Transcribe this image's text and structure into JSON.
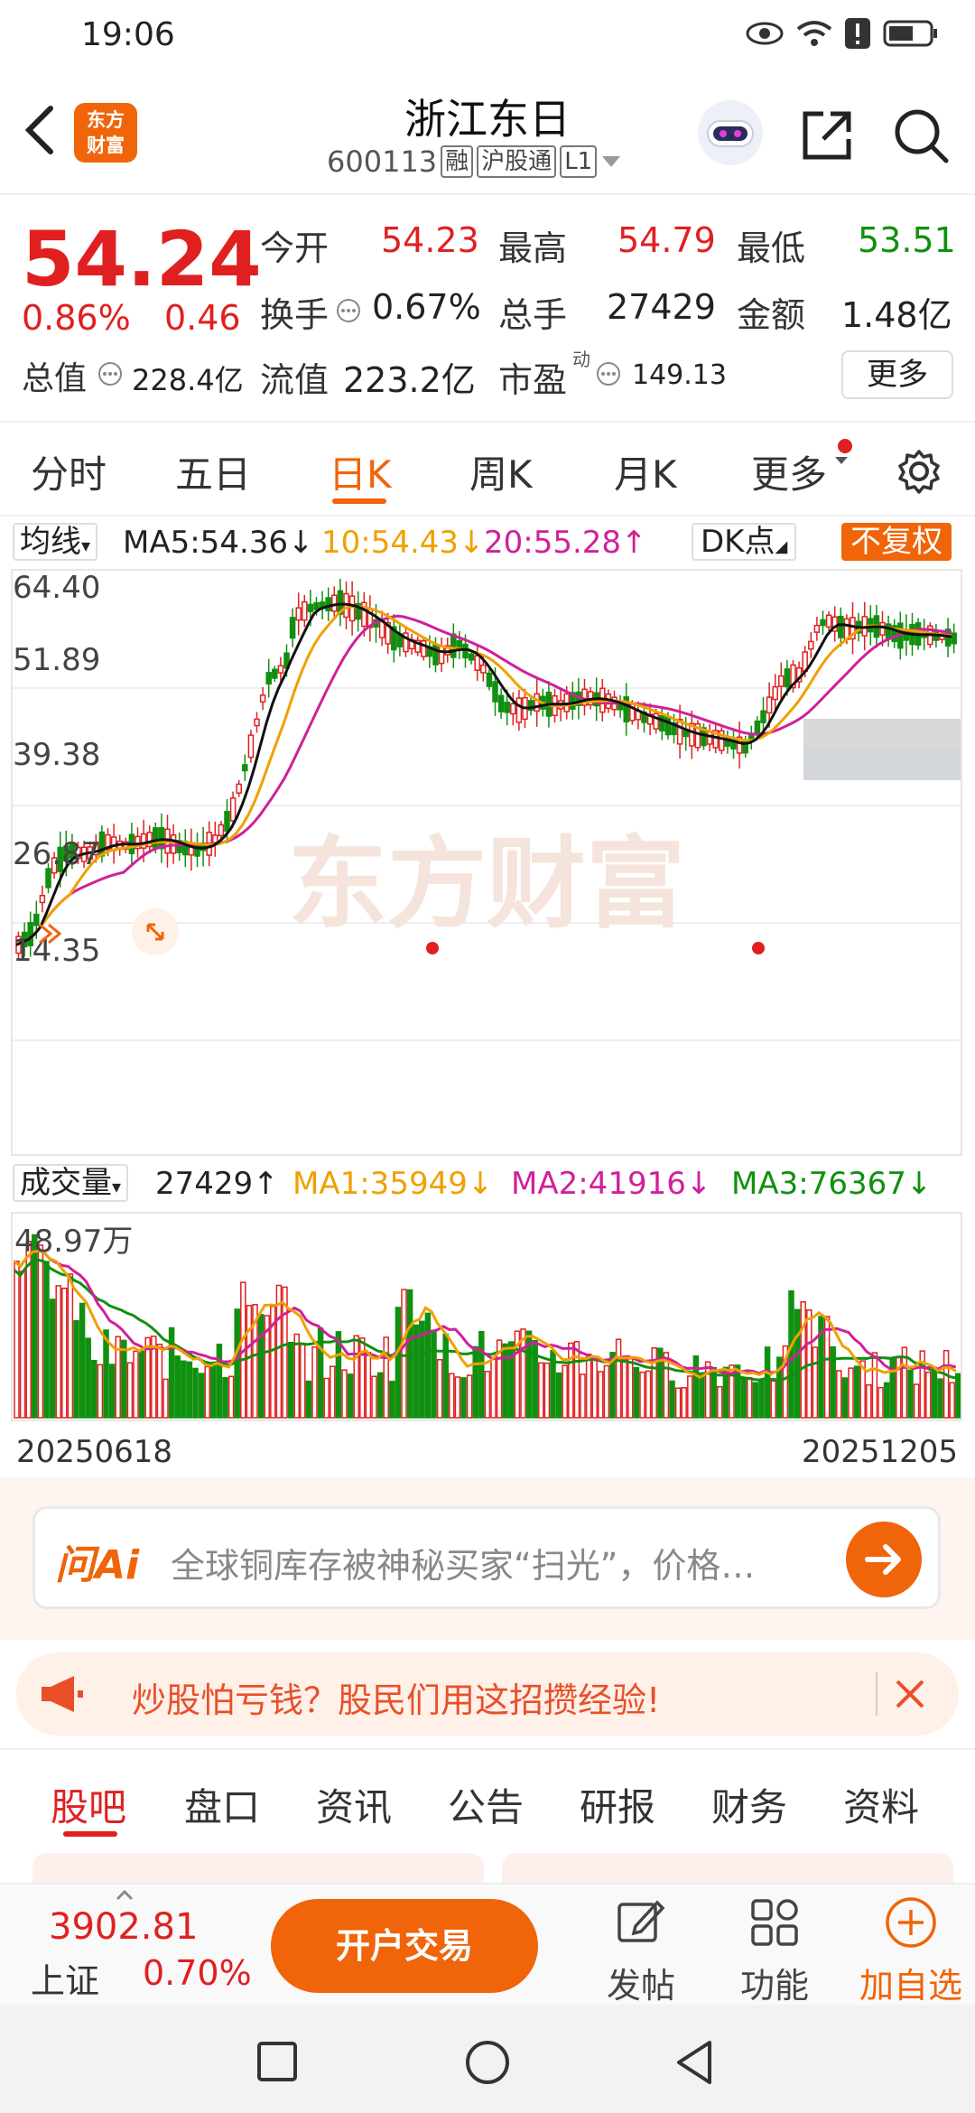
{
  "status": {
    "time": "19:06"
  },
  "header": {
    "logo_line1": "东方",
    "logo_line2": "财富",
    "title": "浙江东日",
    "code": "600113",
    "tags": [
      "融",
      "沪股通",
      "L1"
    ]
  },
  "quote": {
    "price": "54.24",
    "change_pct": "0.86%",
    "change": "0.46",
    "open_label": "今开",
    "open": "54.23",
    "high_label": "最高",
    "high": "54.79",
    "low_label": "最低",
    "low": "53.51",
    "turnover_label": "换手",
    "turnover": "0.67%",
    "volume_label": "总手",
    "volume": "27429",
    "amount_label": "金额",
    "amount": "1.48亿",
    "mktcap_label": "总值",
    "mktcap": "228.4亿",
    "float_label": "流值",
    "float": "223.2亿",
    "pe_label": "市盈",
    "pe_sup": "动",
    "pe": "149.13",
    "more": "更多"
  },
  "tabs": [
    "分时",
    "五日",
    "日K",
    "周K",
    "月K",
    "更多"
  ],
  "active_tab": "日K",
  "ma_bar": {
    "selector": "均线",
    "ma5": "MA5:54.36↓",
    "ma10": "10:54.43↓",
    "ma20": "20:55.28↑",
    "dk": "DK点",
    "fq": "不复权"
  },
  "chart_labels": {
    "y1": "64.40",
    "y2": "51.89",
    "y3": "39.38",
    "y4": "26.87",
    "y5": "14.35",
    "watermark": "东方财富"
  },
  "vol_bar": {
    "selector": "成交量",
    "vol": "27429↑",
    "ma1": "MA1:35949↓",
    "ma2": "MA2:41916↓",
    "ma3": "MA3:76367↓",
    "max_label": "48.97万"
  },
  "dates": {
    "start": "20250618",
    "end": "20251205"
  },
  "ai": {
    "logo": "问Ai",
    "text": "全球铜库存被神秘买家“扫光”，价格…"
  },
  "promo": {
    "text": "炒股怕亏钱？股民们用这招攒经验!"
  },
  "bottom_tabs": [
    "股吧",
    "盘口",
    "资讯",
    "公告",
    "研报",
    "财务",
    "资料"
  ],
  "footer": {
    "index_value": "3902.81",
    "index_name": "上证",
    "index_pct": "0.70%",
    "trade": "开户交易",
    "post": "发帖",
    "func": "功能",
    "add": "加自选"
  },
  "colors": {
    "accent": "#f0640a",
    "up": "#e02020",
    "down": "#109010",
    "ma5": "#111111",
    "ma10": "#f0a000",
    "ma20": "#d0209a"
  }
}
